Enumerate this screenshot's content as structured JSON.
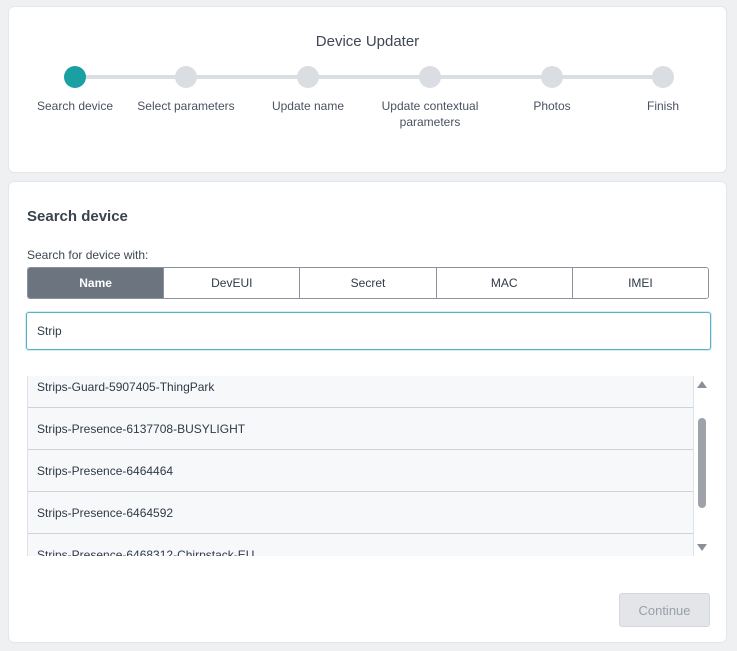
{
  "header": {
    "title": "Device Updater",
    "steps": [
      {
        "label": "Search device",
        "active": true
      },
      {
        "label": "Select parameters",
        "active": false
      },
      {
        "label": "Update name",
        "active": false
      },
      {
        "label": "Update contextual parameters",
        "active": false
      },
      {
        "label": "Photos",
        "active": false
      },
      {
        "label": "Finish",
        "active": false
      }
    ]
  },
  "main": {
    "title": "Search device",
    "search_label": "Search for device with:",
    "search_modes": [
      "Name",
      "DevEUI",
      "Secret",
      "MAC",
      "IMEI"
    ],
    "selected_mode": "Name",
    "search_value": "Strip",
    "results": [
      "Strips-Guard-5907405-ThingPark",
      "Strips-Presence-6137708-BUSYLIGHT",
      "Strips-Presence-6464464",
      "Strips-Presence-6464592",
      "Strips-Presence-6468312-Chirpstack-EU"
    ],
    "continue_label": "Continue"
  },
  "colors": {
    "accent": "#1aa0a3",
    "selected_segment": "#6c757f",
    "inactive_step": "#dadde2"
  }
}
